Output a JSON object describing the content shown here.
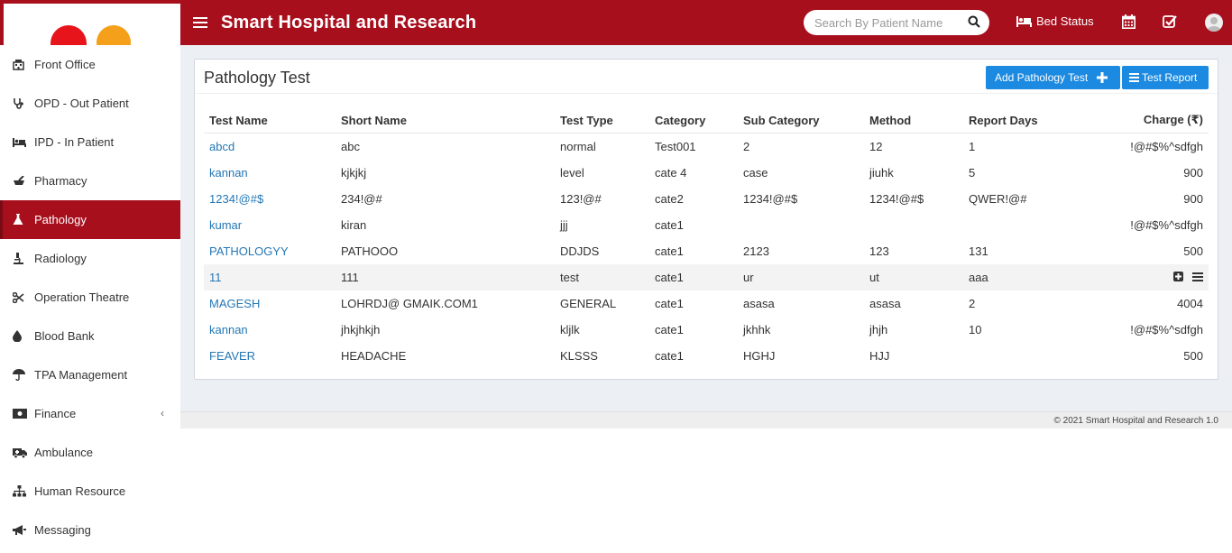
{
  "header": {
    "app_title": "Smart Hospital and Research",
    "search_placeholder": "Search By Patient Name",
    "bed_status": "Bed Status"
  },
  "sidebar": {
    "items": [
      {
        "label": "Front Office",
        "icon": "front-office-icon"
      },
      {
        "label": "OPD - Out Patient",
        "icon": "stethoscope-icon"
      },
      {
        "label": "IPD - In Patient",
        "icon": "bed-icon"
      },
      {
        "label": "Pharmacy",
        "icon": "mortar-pestle-icon"
      },
      {
        "label": "Pathology",
        "icon": "flask-icon",
        "active": true
      },
      {
        "label": "Radiology",
        "icon": "microscope-icon"
      },
      {
        "label": "Operation Theatre",
        "icon": "scissors-icon"
      },
      {
        "label": "Blood Bank",
        "icon": "tint-icon"
      },
      {
        "label": "TPA Management",
        "icon": "umbrella-icon"
      },
      {
        "label": "Finance",
        "icon": "money-icon",
        "chevron": "‹"
      },
      {
        "label": "Ambulance",
        "icon": "ambulance-icon"
      },
      {
        "label": "Human Resource",
        "icon": "sitemap-icon"
      },
      {
        "label": "Messaging",
        "icon": "bullhorn-icon"
      }
    ]
  },
  "main": {
    "title": "Pathology Test",
    "add_button": "Add Pathology Test",
    "report_button": "Test Report",
    "columns": [
      "Test Name",
      "Short Name",
      "Test Type",
      "Category",
      "Sub Category",
      "Method",
      "Report Days",
      "Charge (₹)"
    ],
    "rows": [
      [
        "abcd",
        "abc",
        "normal",
        "Test001",
        "2",
        "12",
        "1",
        "!@#$%^sdfgh"
      ],
      [
        "kannan",
        "kjkjkj",
        "level",
        "cate 4",
        "case",
        "jiuhk",
        "5",
        "900"
      ],
      [
        "1234!@#$",
        "234!@#",
        "123!@#",
        "cate2",
        "1234!@#$",
        "1234!@#$",
        "QWER!@#",
        "900"
      ],
      [
        "kumar",
        "kiran",
        "jjj",
        "cate1",
        "",
        "",
        "",
        "!@#$%^sdfgh"
      ],
      [
        "PATHOLOGYY",
        "PATHOOO",
        "DDJDS",
        "cate1",
        "2123",
        "123",
        "131",
        "500"
      ],
      [
        "11",
        "111",
        "test",
        "cate1",
        "ur",
        "ut",
        "aaa",
        ""
      ],
      [
        "MAGESH",
        "LOHRDJ@ GMAIK.COM1",
        "GENERAL",
        "cate1",
        "asasa",
        "asasa",
        "2",
        "4004"
      ],
      [
        "kannan",
        "jhkjhkjh",
        "kljlk",
        "cate1",
        "jkhhk",
        "jhjh",
        "10",
        "!@#$%^sdfgh"
      ],
      [
        "FEAVER",
        "HEADACHE",
        "KLSSS",
        "cate1",
        "HGHJ",
        "HJJ",
        "",
        "500"
      ]
    ],
    "highlighted_row": 5
  },
  "footer": {
    "text": "© 2021 Smart Hospital and Research 1.0"
  },
  "colors": {
    "brand": "#a80f1d",
    "button": "#1b8ae0",
    "link": "#2477b5"
  }
}
